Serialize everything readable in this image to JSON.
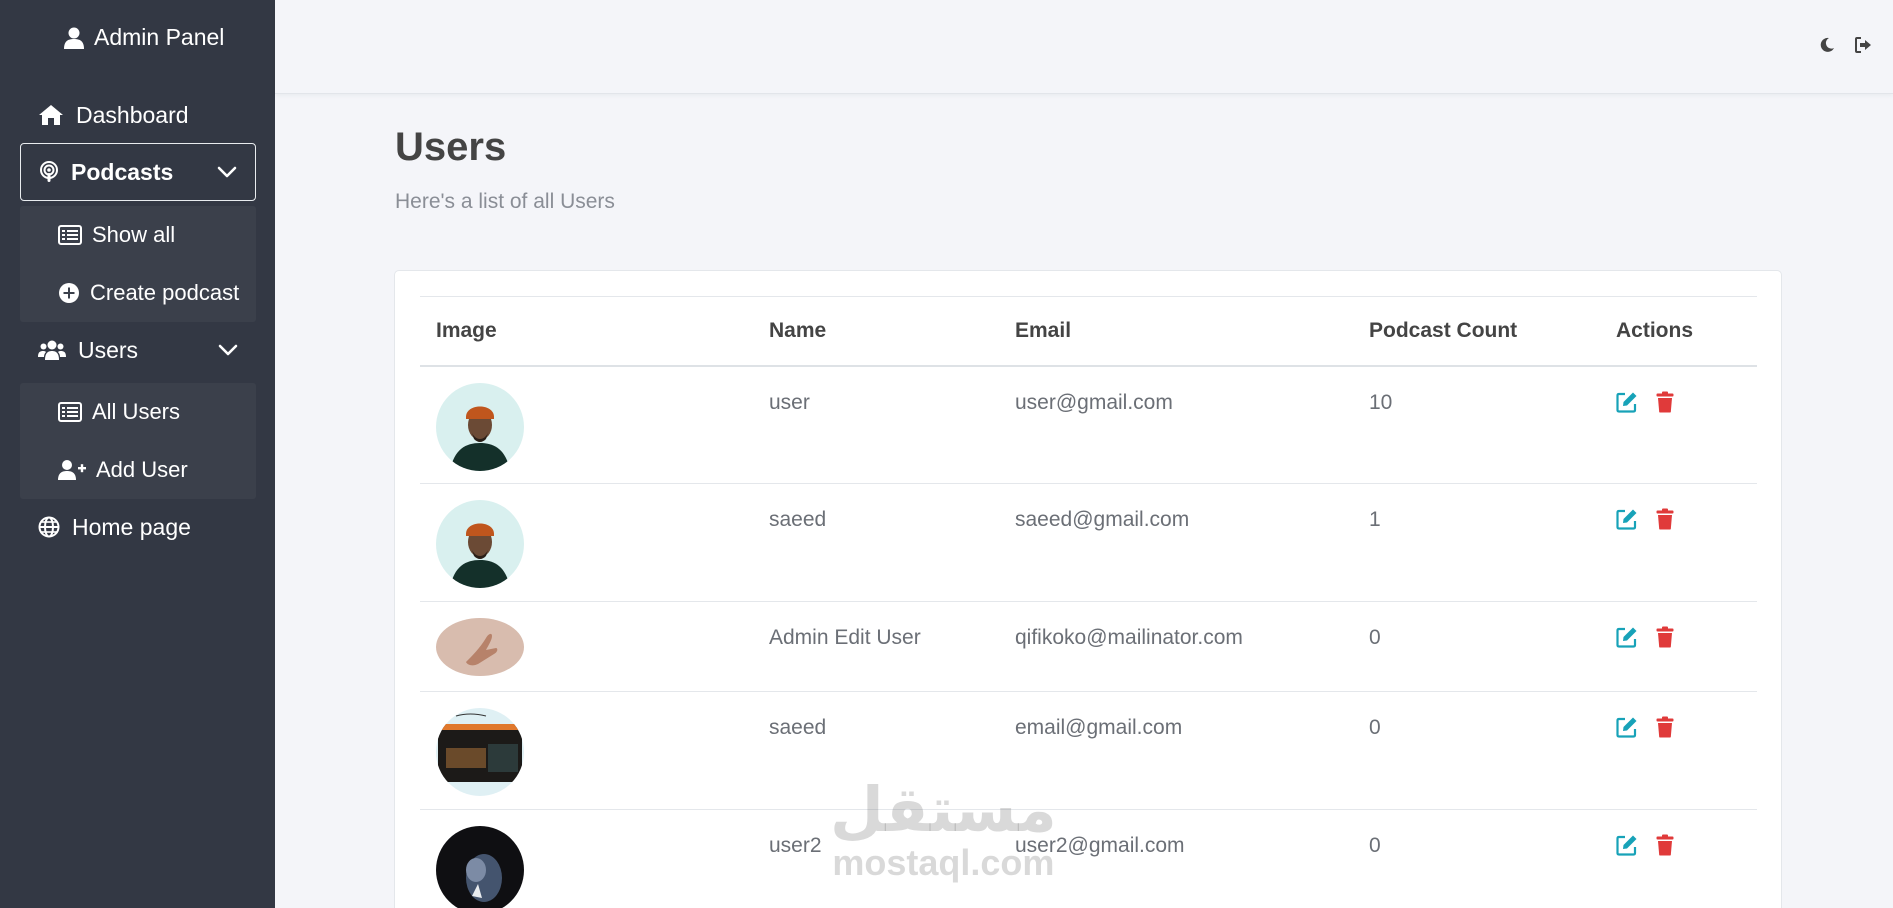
{
  "sidebar": {
    "brand": "Admin Panel",
    "dashboard": "Dashboard",
    "podcasts": "Podcasts",
    "podcasts_sub": [
      "Show all",
      "Create podcast"
    ],
    "users": "Users",
    "users_sub": [
      "All Users",
      "Add User"
    ],
    "home": "Home page"
  },
  "header": {
    "icons": [
      "moon-icon",
      "sign-out-icon"
    ]
  },
  "main": {
    "title": "Users",
    "subtitle": "Here's a list of all Users"
  },
  "table": {
    "columns": [
      "Image",
      "Name",
      "Email",
      "Podcast Count",
      "Actions"
    ],
    "rows": [
      {
        "name": "user",
        "email": "user@gmail.com",
        "count": "10"
      },
      {
        "name": "saeed",
        "email": "saeed@gmail.com",
        "count": "1"
      },
      {
        "name": "Admin Edit User",
        "email": "qifikoko@mailinator.com",
        "count": "0"
      },
      {
        "name": "saeed",
        "email": "email@gmail.com",
        "count": "0"
      },
      {
        "name": "user2",
        "email": "user2@gmail.com",
        "count": "0"
      }
    ]
  },
  "watermark": {
    "arabic": "مستقل",
    "latin": "mostaql.com"
  },
  "colors": {
    "sidebar": "#333844",
    "edit": "#17a2b8",
    "delete": "#e03a3a"
  }
}
